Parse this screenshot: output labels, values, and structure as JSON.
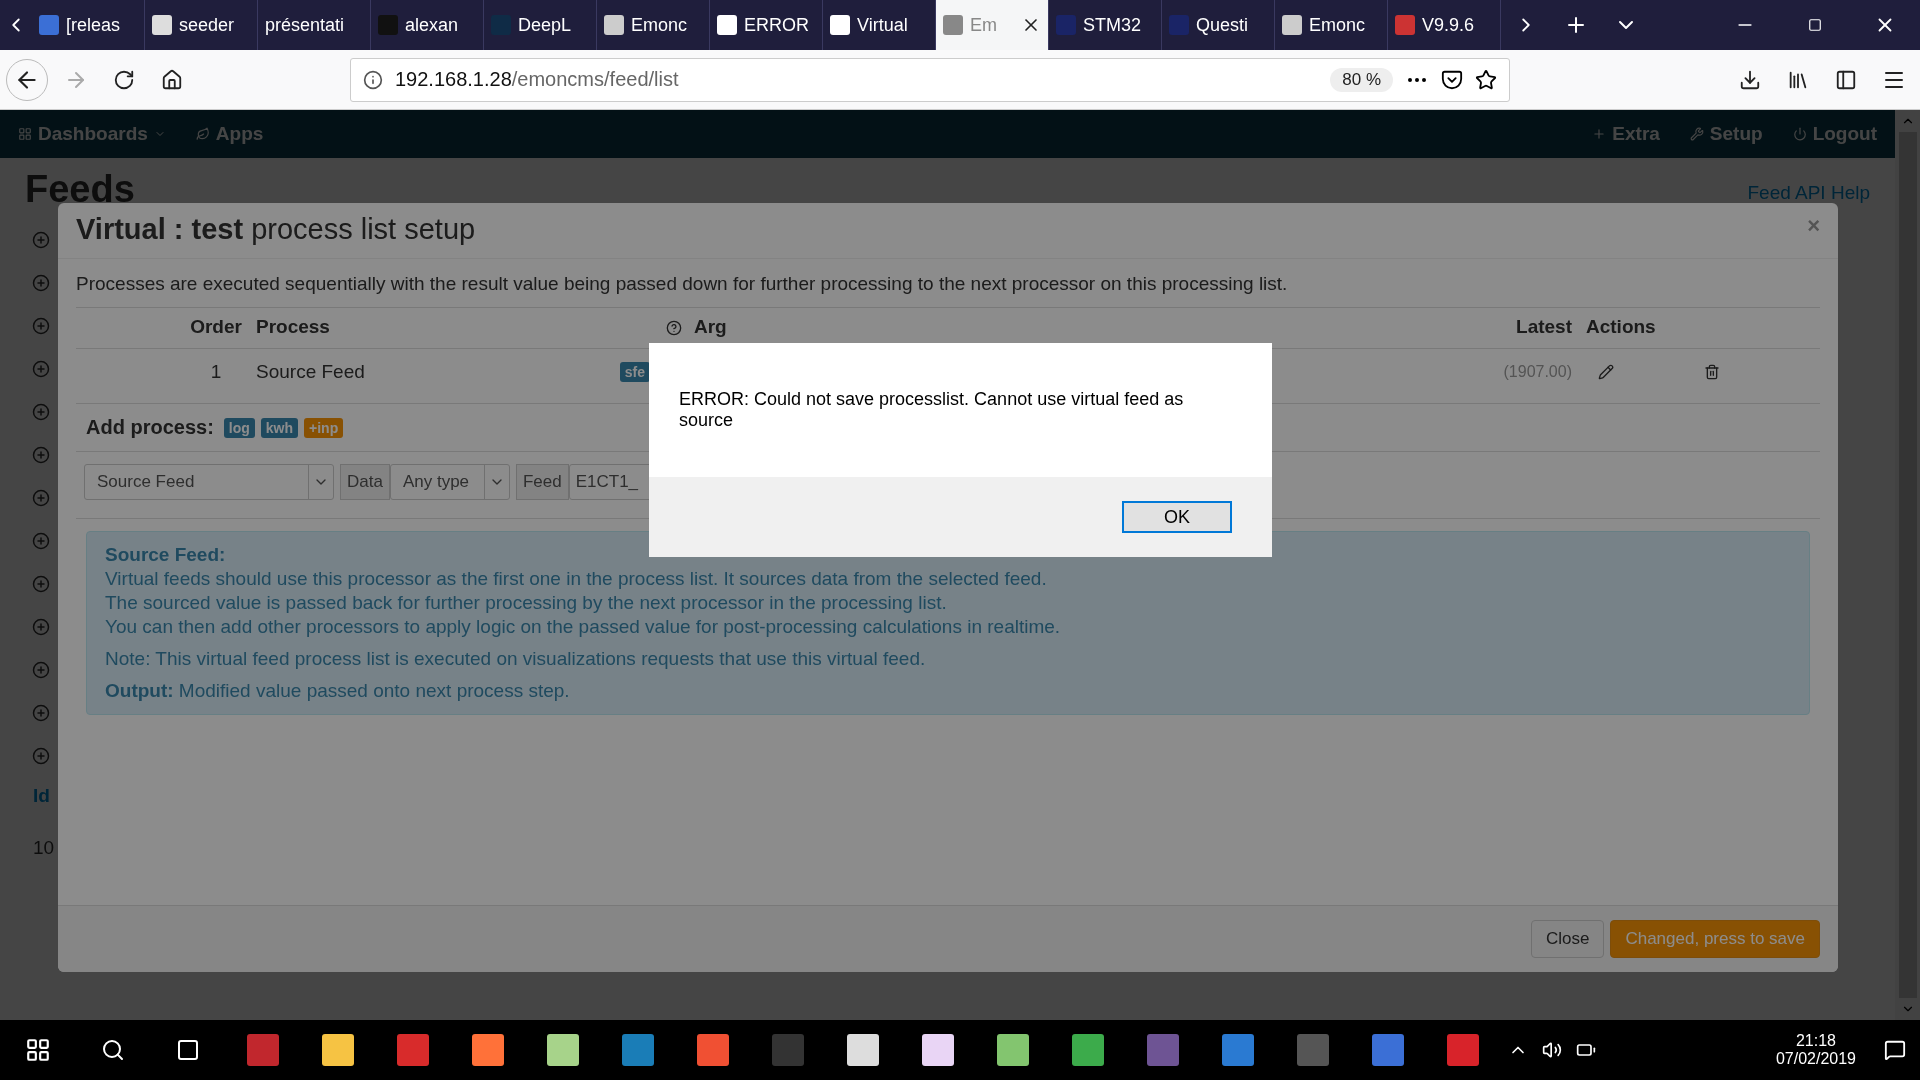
{
  "browser": {
    "tabs": [
      {
        "label": "[releas",
        "selected": false
      },
      {
        "label": "seeder",
        "selected": false
      },
      {
        "label": "présentati",
        "selected": false
      },
      {
        "label": "alexan",
        "selected": false
      },
      {
        "label": "DeepL",
        "selected": false
      },
      {
        "label": "Emonc",
        "selected": false
      },
      {
        "label": "ERROR",
        "selected": false
      },
      {
        "label": "Virtual",
        "selected": false
      },
      {
        "label": "Em",
        "selected": true
      },
      {
        "label": "STM32",
        "selected": false
      },
      {
        "label": "Questi",
        "selected": false
      },
      {
        "label": "Emonc",
        "selected": false
      },
      {
        "label": "V9.9.6",
        "selected": false
      }
    ],
    "url_host": "192.168.1.28",
    "url_path": "/emoncms/feed/list",
    "zoom": "80 %"
  },
  "app_nav": {
    "left": [
      "Dashboards",
      "Apps"
    ],
    "right": [
      "Extra",
      "Setup",
      "Logout"
    ]
  },
  "page": {
    "title": "Feeds",
    "help_link": "Feed API Help",
    "column_1": "Id",
    "cell": "10"
  },
  "modal": {
    "title_bold": "Virtual : test",
    "title_rest": "process list setup",
    "close_glyph": "×",
    "intro": "Processes are executed sequentially with the result value being passed down for further processing to the next processor on this processing list.",
    "columns": [
      "Order",
      "Process",
      "Arg",
      "Latest",
      "Actions"
    ],
    "rows": [
      {
        "order": "1",
        "process": "Source Feed",
        "badge": "sfe",
        "latest": "(1907.00)"
      }
    ],
    "add_process_label": "Add process:",
    "badges": [
      {
        "label": "log",
        "kind": "info"
      },
      {
        "label": "kwh",
        "kind": "info"
      },
      {
        "label": "+inp",
        "kind": "warning"
      }
    ],
    "process_select": "Source Feed",
    "data_addon": "Data",
    "type_select": "Any type",
    "feed_addon": "Feed",
    "feed_select": "E1CT1_",
    "info": {
      "title": "Source Feed:",
      "lines": [
        "Virtual feeds should use this processor as the first one in the process list. It sources data from the selected feed.",
        "The sourced value is passed back for further processing by the next processor in the processing list.",
        "You can then add other processors to apply logic on the passed value for post-processing calculations in realtime."
      ],
      "note": "Note: This virtual feed process list is executed on visualizations requests that use this virtual feed.",
      "output": "**Output:** Modified value passed onto next process step."
    },
    "buttons": [
      {
        "label": "Close",
        "kind": "default"
      },
      {
        "label": "Changed, press to save",
        "kind": "warning"
      }
    ]
  },
  "error_dialog": {
    "message": "ERROR: Could not save processlist. Cannot use virtual feed as source",
    "button": "OK"
  },
  "taskbar": {
    "time": "21:18",
    "date": "07/02/2019"
  }
}
